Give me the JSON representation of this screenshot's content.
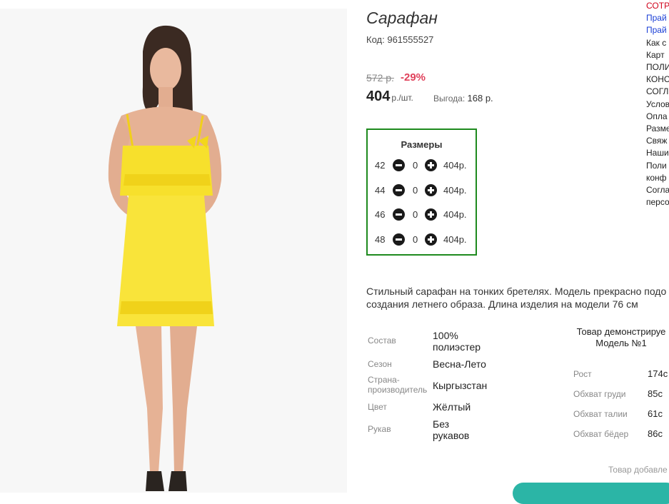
{
  "product": {
    "title": "Сарафан",
    "code_label": "Код:",
    "code_value": "961555527",
    "old_price": "572 р.",
    "discount": "-29%",
    "price": "404",
    "price_unit": "р./шт.",
    "benefit_label": "Выгода:",
    "benefit_value": "168 р.",
    "description_line1": "Стильный сарафан на тонких бретелях. Модель прекрасно подо",
    "description_line2": "создания летнего образа. Длина изделия на модели 76 см"
  },
  "sizes": {
    "header": "Размеры",
    "rows": [
      {
        "size": "42",
        "qty": "0",
        "price": "404р."
      },
      {
        "size": "44",
        "qty": "0",
        "price": "404р."
      },
      {
        "size": "46",
        "qty": "0",
        "price": "404р."
      },
      {
        "size": "48",
        "qty": "0",
        "price": "404р."
      }
    ]
  },
  "attributes": [
    {
      "key": "Состав",
      "value_l1": "100%",
      "value_l2": "полиэстер"
    },
    {
      "key": "Сезон",
      "value_l1": "Весна-Лето",
      "value_l2": ""
    },
    {
      "key_l1": "Страна-",
      "key_l2": "производитель",
      "value_l1": "Кыргызстан",
      "value_l2": ""
    },
    {
      "key": "Цвет",
      "value_l1": "Жёлтый",
      "value_l2": ""
    },
    {
      "key": "Рукав",
      "value_l1": "Без",
      "value_l2": "рукавов"
    }
  ],
  "demo": {
    "line1": "Товар демонстрируе",
    "line2": "Модель №1",
    "measurements": [
      {
        "label": "Рост",
        "value": "174с"
      },
      {
        "label": "Обхват груди",
        "value": "85с"
      },
      {
        "label": "Обхват талии",
        "value": "61с"
      },
      {
        "label": "Обхват бёдер",
        "value": "86с"
      }
    ],
    "added": "Товар добавле"
  },
  "right_nav": [
    {
      "label": "СОТР",
      "color": "red"
    },
    {
      "label": "Прай",
      "color": "blue"
    },
    {
      "label": "Прай",
      "color": "blue"
    },
    {
      "label": "Как с",
      "color": "dark"
    },
    {
      "label": "Карт",
      "color": "dark"
    },
    {
      "label": "ПОЛИ",
      "color": "dark"
    },
    {
      "label": "КОНС",
      "color": "dark"
    },
    {
      "label": "СОГЛ",
      "color": "dark"
    },
    {
      "label": "Услов",
      "color": "dark"
    },
    {
      "label": "Опла",
      "color": "dark"
    },
    {
      "label": "Разме",
      "color": "dark"
    },
    {
      "label": "Свяж",
      "color": "dark"
    },
    {
      "label": "Наши",
      "color": "dark"
    },
    {
      "label": "Поли",
      "color": "dark"
    },
    {
      "label": "конф",
      "color": "dark"
    },
    {
      "label": "Согла",
      "color": "dark"
    },
    {
      "label": "персо",
      "color": "dark"
    }
  ],
  "colors": {
    "discount": "#e0405a",
    "size_box_border": "#1e8a1e",
    "dress": "#f7e02c",
    "nav_red": "#d0021b",
    "nav_blue": "#1a3fd6"
  }
}
